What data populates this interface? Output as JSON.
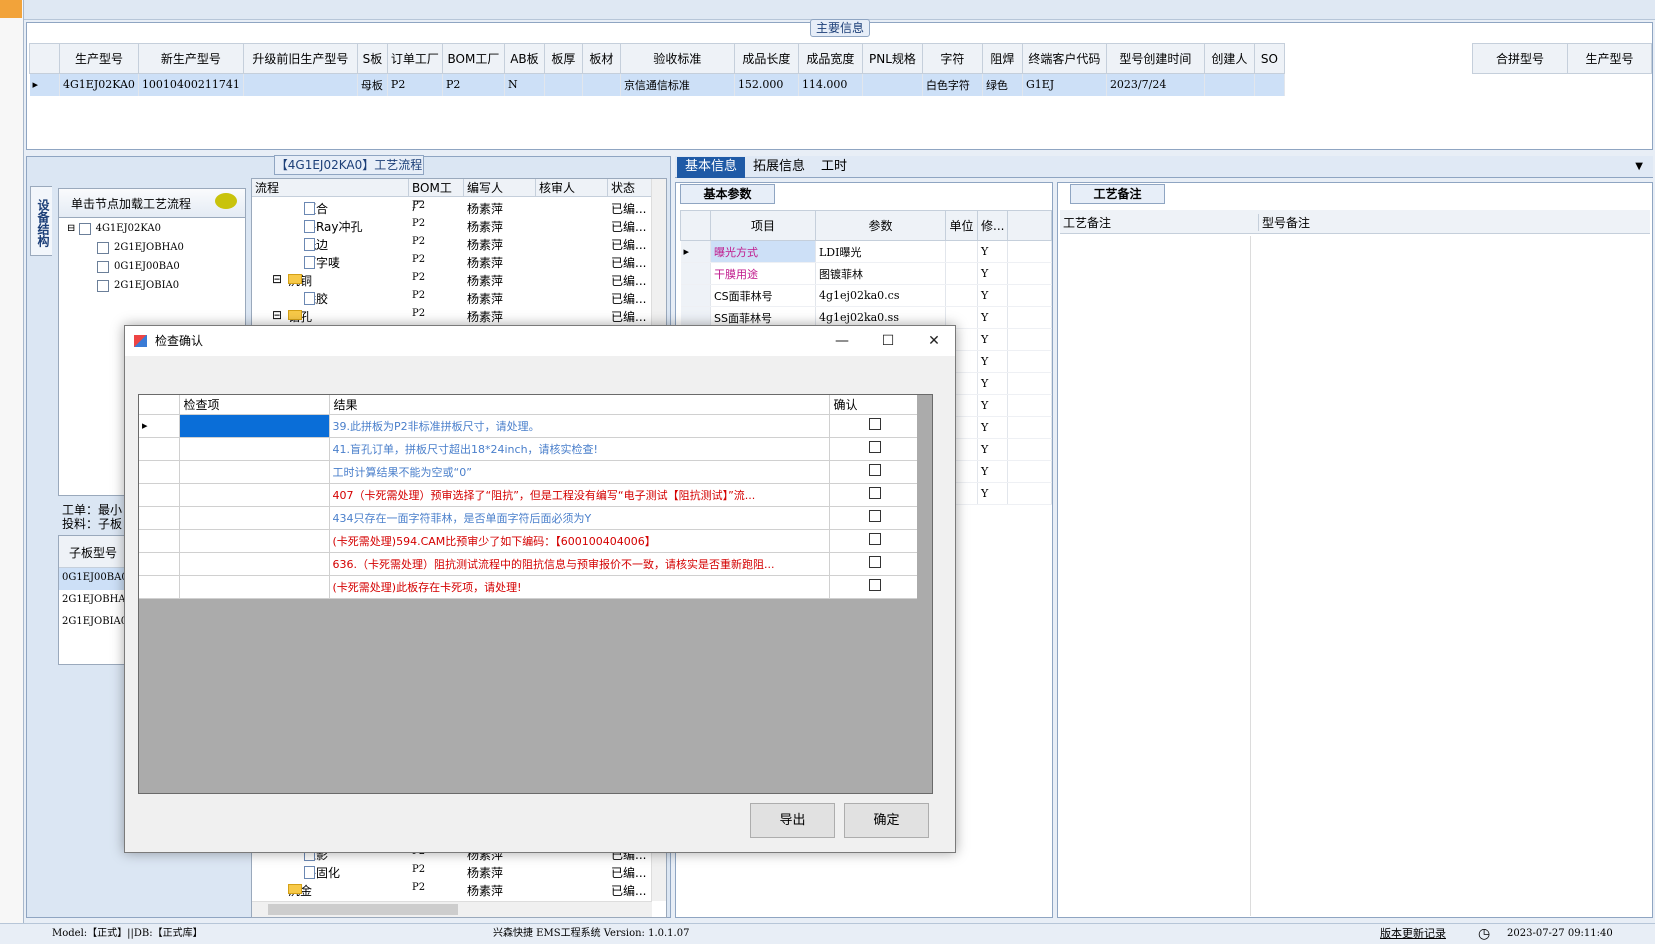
{
  "main_info": {
    "title": "主要信息",
    "columns": [
      "生产型号",
      "新生产型号",
      "升级前旧生产型号",
      "S板",
      "订单工厂",
      "BOM工厂",
      "AB板",
      "板厚",
      "板材",
      "验收标准",
      "成品长度",
      "成品宽度",
      "PNL规格",
      "字符",
      "阻焊",
      "终端客户代码",
      "型号创建时间",
      "创建人",
      "SO"
    ],
    "row": {
      "生产型号": "4G1EJ02KA0",
      "新生产型号": "10010400211741",
      "升级前旧生产型号": "",
      "S板": "母板",
      "订单工厂": "P2",
      "BOM工厂": "P2",
      "AB板": "N",
      "板厚": "",
      "板材": "",
      "验收标准": "京信通信标准",
      "成品长度": "152.000",
      "成品宽度": "114.000",
      "PNL规格": "",
      "字符": "白色字符",
      "阻焊": "绿色",
      "终端客户代码": "G1EJ",
      "型号创建时间": "2023/7/24",
      "创建人": "",
      "SO": ""
    },
    "right_columns": [
      "合拼型号",
      "生产型号"
    ]
  },
  "left_panel": {
    "vertical_tab": "设备结构",
    "tree_header": "单击节点加载工艺流程",
    "tree": {
      "root": "4G1EJ02KA0",
      "children": [
        "2G1EJOBHA0",
        "0G1EJ00BA0",
        "2G1EJOBIA0"
      ]
    },
    "work_label_1": "工单：最小",
    "work_label_2": "投料：子板",
    "sub_header": "子板型号",
    "sub_rows": [
      "0G1EJ00BA0",
      "2G1EJOBHA0",
      "2G1EJOBIA0"
    ]
  },
  "flow": {
    "title": "【4G1EJ02KA0】工艺流程",
    "columns": [
      "流程",
      "BOM工厂",
      "编写人",
      "核审人",
      "状态"
    ],
    "rows": [
      {
        "name": "压合",
        "factory": "P2",
        "writer": "杨素萍",
        "status": "已编..."
      },
      {
        "name": "X-Ray冲孔",
        "factory": "P2",
        "writer": "杨素萍",
        "status": "已编..."
      },
      {
        "name": "铣边",
        "factory": "P2",
        "writer": "杨素萍",
        "status": "已编..."
      },
      {
        "name": "打字唛",
        "factory": "P2",
        "writer": "杨素萍",
        "status": "已编..."
      },
      {
        "name": "沉铜",
        "factory": "P2",
        "writer": "杨素萍",
        "status": "已编..."
      },
      {
        "name": "除胶",
        "factory": "P2",
        "writer": "杨素萍",
        "status": "已编..."
      },
      {
        "name": "钻孔",
        "factory": "P2",
        "writer": "杨素萍",
        "status": "已编..."
      }
    ],
    "bottom_rows": [
      {
        "name": "显影",
        "factory": "P2",
        "writer": "杨素萍",
        "status": "已编..."
      },
      {
        "name": "终固化",
        "factory": "P2",
        "writer": "杨素萍",
        "status": "已编..."
      },
      {
        "name": "沉金",
        "factory": "P2",
        "writer": "杨素萍",
        "status": "已编..."
      }
    ]
  },
  "tabs": [
    "基本信息",
    "拓展信息",
    "工时"
  ],
  "basic": {
    "tab": "基本参数",
    "columns": [
      "项目",
      "参数",
      "单位",
      "修..."
    ],
    "rows": [
      {
        "item": "曝光方式",
        "value": "LDI曝光",
        "flag": "Y",
        "color": "#c0188c"
      },
      {
        "item": "干膜用途",
        "value": "图镀菲林",
        "flag": "Y",
        "color": "#c0188c"
      },
      {
        "item": "CS面菲林号",
        "value": "4g1ej02ka0.cs",
        "flag": "Y",
        "color": "#000000"
      },
      {
        "item": "SS面菲林号",
        "value": "4g1ej02ka0.ss",
        "flag": "Y",
        "color": "#000000"
      }
    ],
    "extra_flags": [
      "Y",
      "Y",
      "Y",
      "Y",
      "Y",
      "Y",
      "Y",
      "Y"
    ]
  },
  "notes": {
    "tab": "工艺备注",
    "col1": "工艺备注",
    "col2": "型号备注"
  },
  "dialog": {
    "title": "检查确认",
    "columns": [
      "检查项",
      "结果",
      "确认"
    ],
    "rows": [
      {
        "result": "39.此拼板为P2非标准拼板尺寸，请处理。",
        "kind": "blue"
      },
      {
        "result": "41.盲孔订单，拼板尺寸超出18*24inch，请核实检查!",
        "kind": "blue"
      },
      {
        "result": "工时计算结果不能为空或“0”",
        "kind": "blue"
      },
      {
        "result": "407（卡死需处理）预审选择了“阻抗”，但是工程没有编写“电子测试【阻抗测试】”流...",
        "kind": "red"
      },
      {
        "result": "434只存在一面字符菲林，是否单面字符后面必须为Y",
        "kind": "blue"
      },
      {
        "result": "(卡死需处理)594.CAM比预审少了如下编码：【600100404006】",
        "kind": "red"
      },
      {
        "result": "636.（卡死需处理）阻抗测试流程中的阻抗信息与预审报价不一致，请核实是否重新跑阻...",
        "kind": "red"
      },
      {
        "result": "(卡死需处理)此板存在卡死项，请处理!",
        "kind": "red"
      }
    ],
    "export_label": "导出",
    "ok_label": "确定"
  },
  "status": {
    "left": "Model:【正式】||DB:【正式库】",
    "center": "兴森快捷 EMS工程系统 Version: 1.0.1.07",
    "link": "版本更新记录",
    "time": "2023-07-27 09:11:40"
  },
  "colors": {
    "accent": "#1f5aa6",
    "red": "#d40000",
    "blue": "#4a7fcb"
  }
}
